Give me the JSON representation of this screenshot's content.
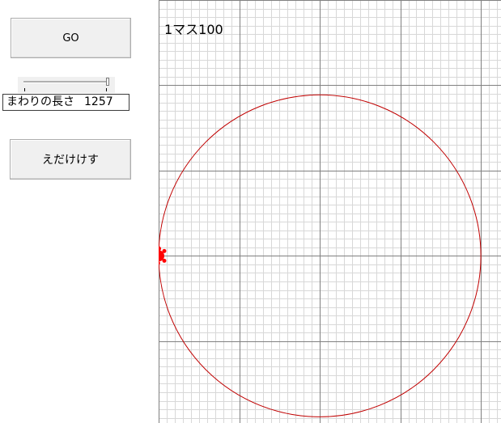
{
  "controls": {
    "go_label": "GO",
    "erase_label": "えだけけす",
    "perimeter_label": "まわりの長さ",
    "perimeter_value": "1257"
  },
  "slider": {
    "min": 0,
    "max": 100,
    "value": 100
  },
  "canvas": {
    "scale_label": "1マス100",
    "grid_unit": 100,
    "x_range": [
      -200,
      225
    ],
    "y_range": [
      -196,
      300
    ],
    "circle": {
      "center": [
        0,
        0
      ],
      "radius": 200,
      "color": "#c00000"
    },
    "turtle": {
      "position": [
        -200,
        0
      ],
      "color": "#ff0000"
    },
    "major_grid_color": "#808080",
    "minor_grid_color": "#d8d8d8"
  }
}
